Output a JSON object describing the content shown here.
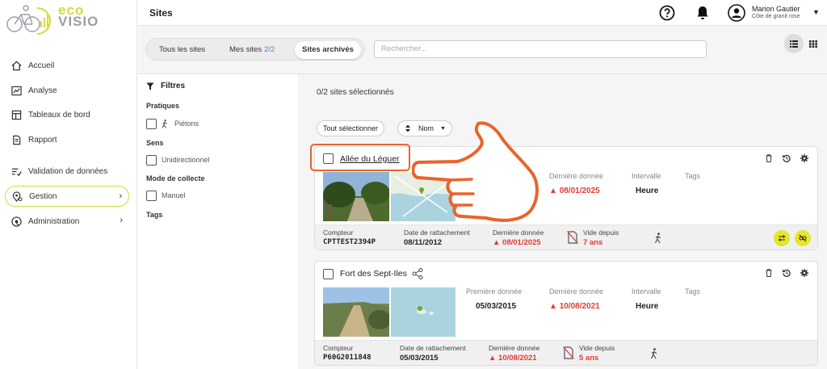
{
  "brand": {
    "eco": "eco",
    "visio": "VISIO",
    "accent": "#d8d93a"
  },
  "sidebar": {
    "items": [
      {
        "label": "Accueil",
        "icon": "home-icon"
      },
      {
        "label": "Analyse",
        "icon": "analysis-icon"
      },
      {
        "label": "Tableaux de bord",
        "icon": "dashboard-icon"
      },
      {
        "label": "Rapport",
        "icon": "report-icon"
      },
      {
        "label": "Validation de données",
        "icon": "validation-icon"
      },
      {
        "label": "Gestion",
        "icon": "location-settings-icon",
        "active": true
      },
      {
        "label": "Administration",
        "icon": "admin-icon"
      }
    ]
  },
  "header": {
    "title": "Sites",
    "user_name": "Marion Gautier",
    "user_org": "Côte de granit rose"
  },
  "tabs": {
    "all": "Tous les sites",
    "mine": "Mes sites",
    "mine_count": "2/2",
    "archived": "Sites archivés"
  },
  "search": {
    "placeholder": "Rechercher..."
  },
  "filters": {
    "title": "Filtres",
    "sections": {
      "pratiques": "Pratiques",
      "sens": "Sens",
      "mode": "Mode de collecte",
      "tags": "Tags"
    },
    "options": {
      "pietons": "Piétons",
      "unidirectionnel": "Unidirectionnel",
      "manuel": "Manuel"
    }
  },
  "list": {
    "selection_count": "0/2 sites sélectionnés",
    "select_all": "Tout sélectionner",
    "sort_label": "Nom"
  },
  "labels": {
    "premiere": "Première donnée",
    "derniere": "Dernière donnée",
    "intervalle": "Intervalle",
    "tags": "Tags",
    "compteur": "Compteur",
    "rattachement": "Date de rattachement",
    "vide": "Vide depuis"
  },
  "sites": [
    {
      "name": "Allée du Léguer",
      "last_data": "08/01/2025",
      "interval": "Heure",
      "counter": "CPTTEST2394P",
      "attach_date": "08/11/2012",
      "footer_last": "08/01/2025",
      "empty_since": "7 ans"
    },
    {
      "name": "Fort des Sept-Iles",
      "first_data": "05/03/2015",
      "last_data": "10/08/2021",
      "interval": "Heure",
      "counter": "P60G2011848",
      "attach_date": "05/03/2015",
      "footer_last": "10/08/2021",
      "empty_since": "5 ans"
    }
  ]
}
